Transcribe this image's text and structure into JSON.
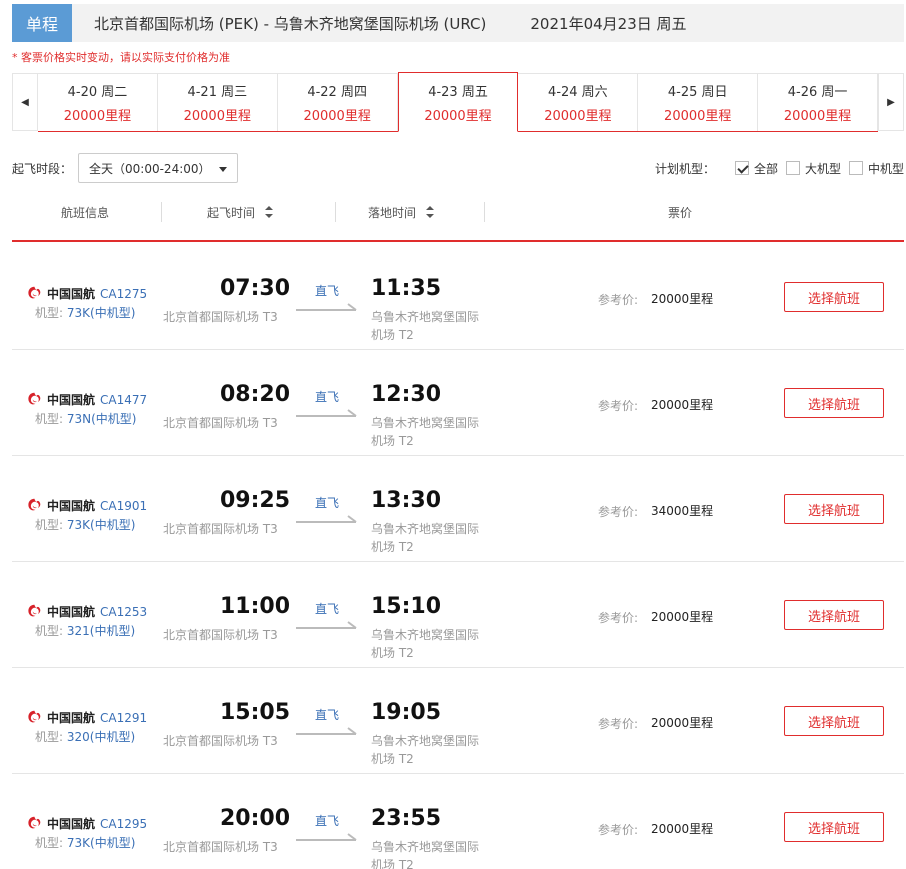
{
  "header": {
    "trip_type": "单程",
    "route": "北京首都国际机场 (PEK) - 乌鲁木齐地窝堡国际机场 (URC)",
    "date": "2021年04月23日 周五"
  },
  "notice": "* 客票价格实时变动，请以实际支付价格为准",
  "date_tabs": [
    {
      "date": "4-20 周二",
      "price": "20000里程",
      "active": false
    },
    {
      "date": "4-21 周三",
      "price": "20000里程",
      "active": false
    },
    {
      "date": "4-22 周四",
      "price": "20000里程",
      "active": false
    },
    {
      "date": "4-23 周五",
      "price": "20000里程",
      "active": true
    },
    {
      "date": "4-24 周六",
      "price": "20000里程",
      "active": false
    },
    {
      "date": "4-25 周日",
      "price": "20000里程",
      "active": false
    },
    {
      "date": "4-26 周一",
      "price": "20000里程",
      "active": false
    }
  ],
  "nav_icons": {
    "prev": "left-arrow-icon",
    "next": "right-arrow-icon"
  },
  "filter": {
    "time_label": "起飞时段：",
    "time_value": "全天（00:00-24:00）",
    "plane_label": "计划机型：",
    "plane_options": [
      {
        "label": "全部",
        "checked": true
      },
      {
        "label": "大机型",
        "checked": false
      },
      {
        "label": "中机型",
        "checked": false
      }
    ]
  },
  "columns": {
    "info": "航班信息",
    "depart": "起飞时间",
    "arrive": "落地时间",
    "price": "票价"
  },
  "flights": [
    {
      "airline": "中国国航",
      "flight_no": "CA1275",
      "plane_label": "机型:",
      "plane": "73K(中机型)",
      "dep_time": "07:30",
      "dep_airport": "北京首都国际机场 T3",
      "direct": "直飞",
      "arr_time": "11:35",
      "arr_airport": "乌鲁木齐地窝堡国际机场 T2",
      "price_label": "参考价:",
      "price": "20000里程",
      "button": "选择航班"
    },
    {
      "airline": "中国国航",
      "flight_no": "CA1477",
      "plane_label": "机型:",
      "plane": "73N(中机型)",
      "dep_time": "08:20",
      "dep_airport": "北京首都国际机场 T3",
      "direct": "直飞",
      "arr_time": "12:30",
      "arr_airport": "乌鲁木齐地窝堡国际机场 T2",
      "price_label": "参考价:",
      "price": "20000里程",
      "button": "选择航班"
    },
    {
      "airline": "中国国航",
      "flight_no": "CA1901",
      "plane_label": "机型:",
      "plane": "73K(中机型)",
      "dep_time": "09:25",
      "dep_airport": "北京首都国际机场 T3",
      "direct": "直飞",
      "arr_time": "13:30",
      "arr_airport": "乌鲁木齐地窝堡国际机场 T2",
      "price_label": "参考价:",
      "price": "34000里程",
      "button": "选择航班"
    },
    {
      "airline": "中国国航",
      "flight_no": "CA1253",
      "plane_label": "机型:",
      "plane": "321(中机型)",
      "dep_time": "11:00",
      "dep_airport": "北京首都国际机场 T3",
      "direct": "直飞",
      "arr_time": "15:10",
      "arr_airport": "乌鲁木齐地窝堡国际机场 T2",
      "price_label": "参考价:",
      "price": "20000里程",
      "button": "选择航班"
    },
    {
      "airline": "中国国航",
      "flight_no": "CA1291",
      "plane_label": "机型:",
      "plane": "320(中机型)",
      "dep_time": "15:05",
      "dep_airport": "北京首都国际机场 T3",
      "direct": "直飞",
      "arr_time": "19:05",
      "arr_airport": "乌鲁木齐地窝堡国际机场 T2",
      "price_label": "参考价:",
      "price": "20000里程",
      "button": "选择航班"
    },
    {
      "airline": "中国国航",
      "flight_no": "CA1295",
      "plane_label": "机型:",
      "plane": "73K(中机型)",
      "dep_time": "20:00",
      "dep_airport": "北京首都国际机场 T3",
      "direct": "直飞",
      "arr_time": "23:55",
      "arr_airport": "乌鲁木齐地窝堡国际机场 T2",
      "price_label": "参考价:",
      "price": "20000里程",
      "button": "选择航班"
    }
  ],
  "colors": {
    "accent_red": "#e02d2d",
    "badge_blue": "#5b9bd5",
    "link_blue": "#3a6fb5"
  }
}
